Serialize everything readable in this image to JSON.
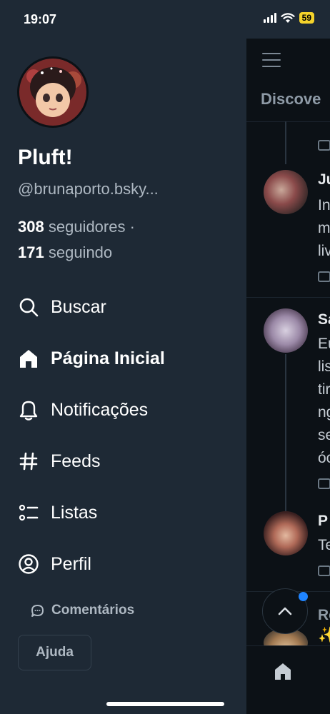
{
  "status_bar": {
    "time": "19:07",
    "battery": "59"
  },
  "drawer": {
    "profile": {
      "display_name": "Pluft!",
      "handle": "@brunaporto.bsky...",
      "followers_count": "308",
      "followers_label": "seguidores ·",
      "following_count": "171",
      "following_label": "seguindo"
    },
    "menu": [
      {
        "label": "Buscar",
        "icon": "search-icon",
        "active": false
      },
      {
        "label": "Página Inicial",
        "icon": "home-icon",
        "active": true
      },
      {
        "label": "Notificações",
        "icon": "bell-icon",
        "active": false
      },
      {
        "label": "Feeds",
        "icon": "hash-icon",
        "active": false
      },
      {
        "label": "Listas",
        "icon": "list-icon",
        "active": false
      },
      {
        "label": "Perfil",
        "icon": "user-circle-icon",
        "active": false
      }
    ],
    "feedback_label": "Comentários",
    "help_label": "Ajuda"
  },
  "background_feed": {
    "tab_title": "Discove",
    "posts": [
      {
        "author": "Ju",
        "lines": [
          "In",
          "m",
          "liv"
        ]
      },
      {
        "author": "Sa",
        "lines": [
          "Eu",
          "lis",
          "tir",
          "ng",
          "se",
          "óc"
        ]
      },
      {
        "author": "P",
        "lines": [
          "Te"
        ]
      },
      {
        "author": "Ro",
        "lines": [
          "✨"
        ]
      }
    ]
  },
  "colors": {
    "drawer_bg": "#1e2935",
    "background": "#0c1116",
    "accent": "#1f84ff",
    "muted_text": "#aeb8c2"
  }
}
